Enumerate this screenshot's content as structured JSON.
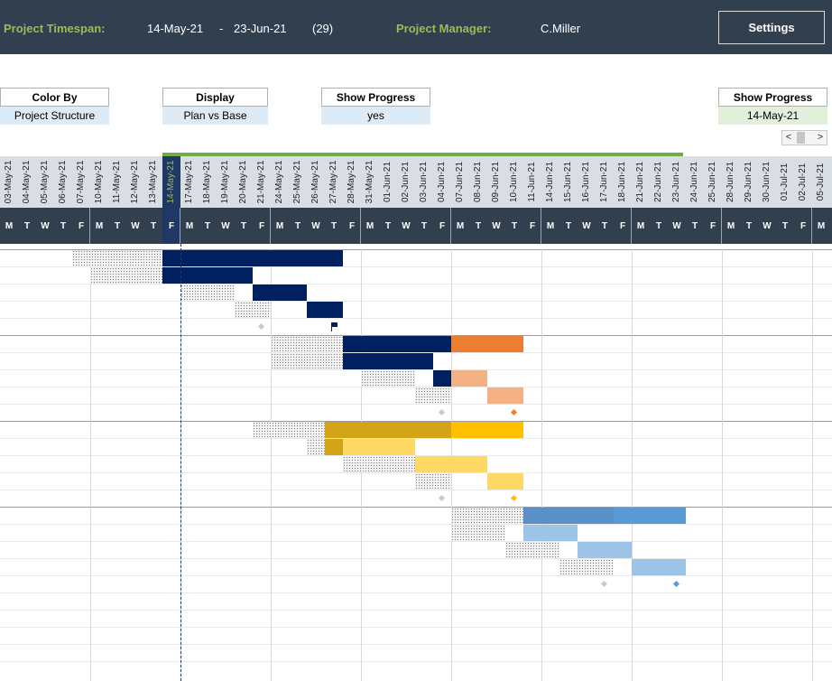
{
  "header": {
    "timespan_label": "Project Timespan:",
    "start": "14-May-21",
    "dash": "-",
    "end": "23-Jun-21",
    "duration": "(29)",
    "manager_label": "Project Manager:",
    "manager": "C.Miller",
    "settings_label": "Settings"
  },
  "controls": {
    "color_by": {
      "label": "Color By",
      "value": "Project Structure"
    },
    "display": {
      "label": "Display",
      "value": "Plan vs Base"
    },
    "show_progress": {
      "label": "Show Progress",
      "value": "yes"
    },
    "progress_date": {
      "label": "Show Progress",
      "value": "14-May-21"
    }
  },
  "scroll": {
    "left": "<",
    "right": ">"
  },
  "timeline": {
    "dates": [
      "03-May-21",
      "04-May-21",
      "05-May-21",
      "06-May-21",
      "07-May-21",
      "10-May-21",
      "11-May-21",
      "12-May-21",
      "13-May-21",
      "14-May-21",
      "17-May-21",
      "18-May-21",
      "19-May-21",
      "20-May-21",
      "21-May-21",
      "24-May-21",
      "25-May-21",
      "26-May-21",
      "27-May-21",
      "28-May-21",
      "31-May-21",
      "01-Jun-21",
      "02-Jun-21",
      "03-Jun-21",
      "04-Jun-21",
      "07-Jun-21",
      "08-Jun-21",
      "09-Jun-21",
      "10-Jun-21",
      "11-Jun-21",
      "14-Jun-21",
      "15-Jun-21",
      "16-Jun-21",
      "17-Jun-21",
      "18-Jun-21",
      "21-Jun-21",
      "22-Jun-21",
      "23-Jun-21",
      "24-Jun-21",
      "25-Jun-21",
      "28-Jun-21",
      "29-Jun-21",
      "30-Jun-21",
      "01-Jul-21",
      "02-Jul-21",
      "05-Jul-21"
    ],
    "weekdays": [
      "M",
      "T",
      "W",
      "T",
      "F",
      "M",
      "T",
      "W",
      "T",
      "F",
      "M",
      "T",
      "W",
      "T",
      "F",
      "M",
      "T",
      "W",
      "T",
      "F",
      "M",
      "T",
      "W",
      "T",
      "F",
      "M",
      "T",
      "W",
      "T",
      "F",
      "M",
      "T",
      "W",
      "T",
      "F",
      "M",
      "T",
      "W",
      "T",
      "F",
      "M",
      "T",
      "W",
      "T",
      "F",
      "M"
    ],
    "today_index": 9
  },
  "colors": {
    "dark_blue": "#002060",
    "orange": "#ed7d31",
    "light_orange": "#f4b183",
    "gold": "#ffc000",
    "light_gold": "#ffd966",
    "blue": "#5b9bd5",
    "light_blue": "#9dc3e6",
    "gray_diamond": "#c9c9c9"
  },
  "gantt": {
    "rows": 25,
    "group_rows": [
      0,
      5,
      10,
      15
    ],
    "baselines": [
      {
        "row": 0,
        "start": 4,
        "end": 9
      },
      {
        "row": 1,
        "start": 5,
        "end": 9
      },
      {
        "row": 2,
        "start": 10,
        "end": 13
      },
      {
        "row": 3,
        "start": 13,
        "end": 15
      },
      {
        "row": 5,
        "start": 15,
        "end": 19
      },
      {
        "row": 6,
        "start": 15,
        "end": 19
      },
      {
        "row": 7,
        "start": 20,
        "end": 23
      },
      {
        "row": 8,
        "start": 23,
        "end": 25
      },
      {
        "row": 10,
        "start": 14,
        "end": 18
      },
      {
        "row": 11,
        "start": 17,
        "end": 20
      },
      {
        "row": 12,
        "start": 19,
        "end": 23
      },
      {
        "row": 13,
        "start": 23,
        "end": 25
      },
      {
        "row": 15,
        "start": 25,
        "end": 29
      },
      {
        "row": 16,
        "start": 25,
        "end": 28
      },
      {
        "row": 17,
        "start": 28,
        "end": 31
      },
      {
        "row": 18,
        "start": 31,
        "end": 34
      }
    ],
    "bars": [
      {
        "row": 0,
        "start": 9,
        "end": 19,
        "color": "#002060"
      },
      {
        "row": 1,
        "start": 9,
        "end": 14,
        "color": "#002060"
      },
      {
        "row": 2,
        "start": 14,
        "end": 17,
        "color": "#002060"
      },
      {
        "row": 3,
        "start": 17,
        "end": 19,
        "color": "#002060"
      },
      {
        "row": 5,
        "start": 19,
        "end": 25,
        "color": "#002060"
      },
      {
        "row": 5,
        "start": 25,
        "end": 29,
        "color": "#ed7d31"
      },
      {
        "row": 6,
        "start": 19,
        "end": 24,
        "color": "#002060"
      },
      {
        "row": 7,
        "start": 24,
        "end": 25,
        "color": "#002060"
      },
      {
        "row": 7,
        "start": 25,
        "end": 27,
        "color": "#f4b183"
      },
      {
        "row": 8,
        "start": 27,
        "end": 29,
        "color": "#f4b183"
      },
      {
        "row": 10,
        "start": 18,
        "end": 25,
        "color": "#d4a418"
      },
      {
        "row": 10,
        "start": 25,
        "end": 29,
        "color": "#ffc000"
      },
      {
        "row": 11,
        "start": 18,
        "end": 19,
        "color": "#d4a418"
      },
      {
        "row": 11,
        "start": 19,
        "end": 23,
        "color": "#ffd966"
      },
      {
        "row": 12,
        "start": 23,
        "end": 27,
        "color": "#ffd966"
      },
      {
        "row": 13,
        "start": 27,
        "end": 29,
        "color": "#ffd966"
      },
      {
        "row": 15,
        "start": 29,
        "end": 34,
        "color": "#5b8fc7"
      },
      {
        "row": 15,
        "start": 34,
        "end": 38,
        "color": "#5b9bd5"
      },
      {
        "row": 16,
        "start": 29,
        "end": 32,
        "color": "#9dc3e6"
      },
      {
        "row": 17,
        "start": 32,
        "end": 35,
        "color": "#9dc3e6"
      },
      {
        "row": 18,
        "start": 35,
        "end": 38,
        "color": "#9dc3e6"
      }
    ],
    "milestones": [
      {
        "row": 4,
        "col": 14,
        "color": "#c9c9c9",
        "type": "diamond"
      },
      {
        "row": 4,
        "col": 18,
        "color": "#002060",
        "type": "flag"
      },
      {
        "row": 9,
        "col": 24,
        "color": "#c9c9c9",
        "type": "diamond"
      },
      {
        "row": 9,
        "col": 28,
        "color": "#ed7d31",
        "type": "diamond"
      },
      {
        "row": 14,
        "col": 24,
        "color": "#c9c9c9",
        "type": "diamond"
      },
      {
        "row": 14,
        "col": 28,
        "color": "#ffc000",
        "type": "diamond"
      },
      {
        "row": 19,
        "col": 33,
        "color": "#c9c9c9",
        "type": "diamond"
      },
      {
        "row": 19,
        "col": 37,
        "color": "#5b9bd5",
        "type": "diamond"
      }
    ]
  }
}
